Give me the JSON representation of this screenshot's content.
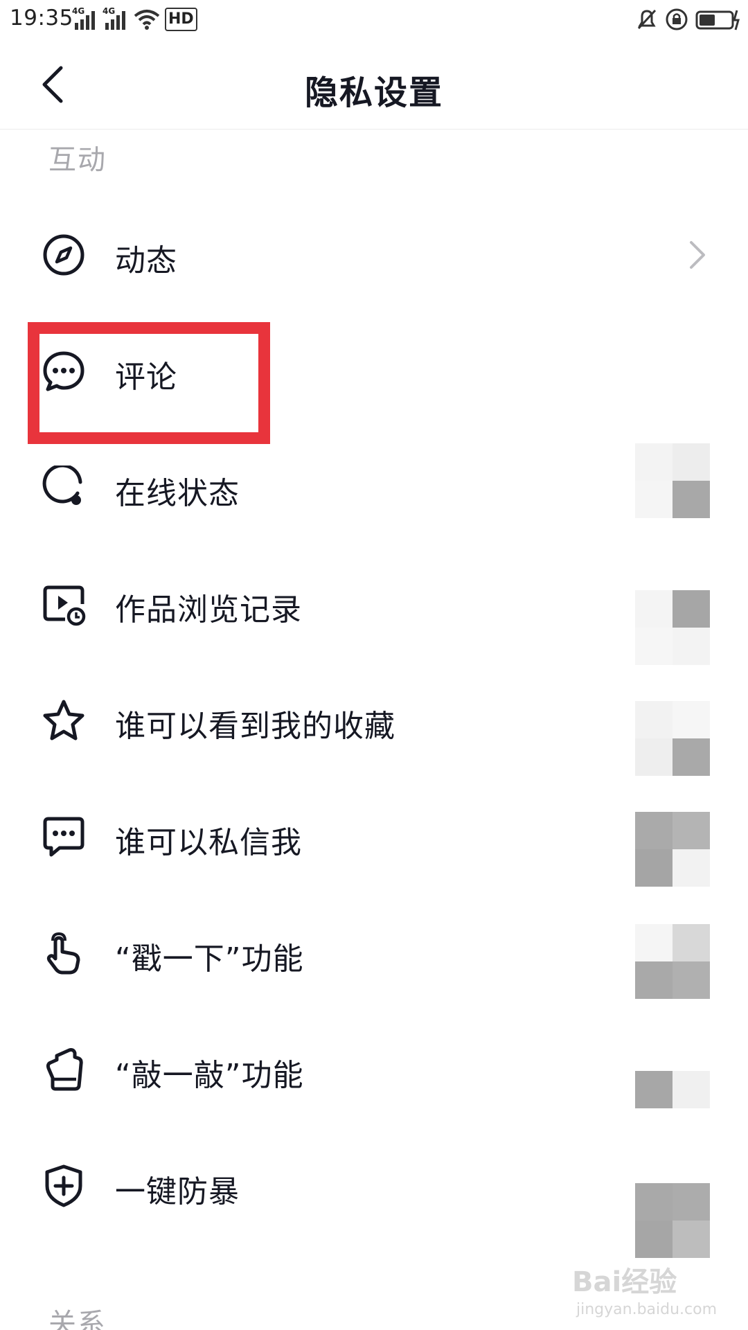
{
  "status_bar": {
    "time": "19:35",
    "network_1": "4G",
    "network_2": "4G",
    "hd_label": "HD"
  },
  "header": {
    "title": "隐私设置"
  },
  "sections": {
    "interaction": "互动",
    "relations": "关系"
  },
  "items": [
    {
      "label": "动态",
      "icon": "compass-icon",
      "has_chevron": true
    },
    {
      "label": "评论",
      "icon": "comment-icon",
      "highlighted": true
    },
    {
      "label": "在线状态",
      "icon": "online-status-icon"
    },
    {
      "label": "作品浏览记录",
      "icon": "video-history-icon"
    },
    {
      "label": "谁可以看到我的收藏",
      "icon": "star-icon"
    },
    {
      "label": "谁可以私信我",
      "icon": "message-icon"
    },
    {
      "label": "“戳一下”功能",
      "icon": "poke-hand-icon"
    },
    {
      "label": "“敲一敲”功能",
      "icon": "knock-hand-icon"
    },
    {
      "label": "一键防暴",
      "icon": "shield-plus-icon"
    }
  ],
  "watermark": {
    "text": "Bai经验",
    "sub": "jingyan.baidu.com"
  },
  "colors": {
    "highlight": "#e8343c",
    "section_header": "#a8a8ad",
    "text": "#161823"
  }
}
